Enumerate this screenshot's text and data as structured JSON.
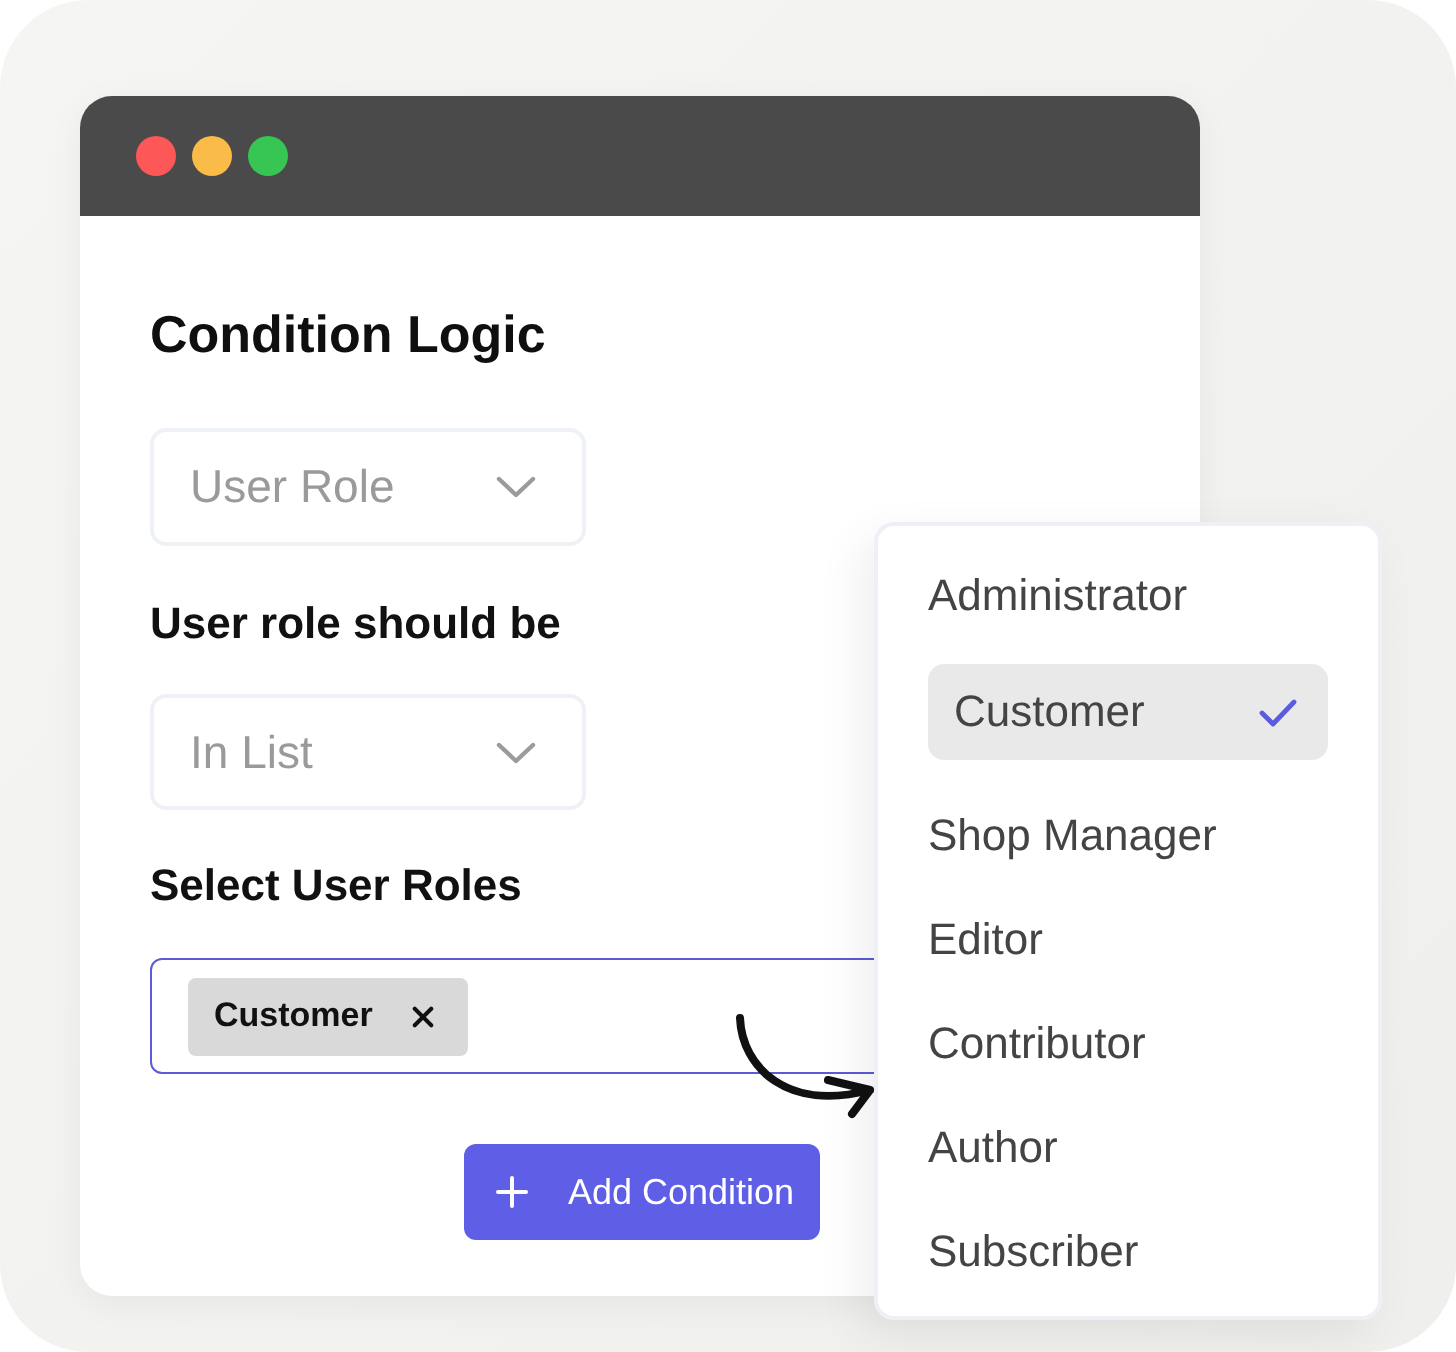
{
  "heading": "Condition Logic",
  "rule_select": {
    "value": "User Role"
  },
  "operator_label": "User role should be",
  "operator_select": {
    "value": "In List"
  },
  "roles_label": "Select User Roles",
  "roles_field": {
    "focused": true,
    "tags": [
      {
        "label": "Customer"
      }
    ]
  },
  "add_button": {
    "label": "Add Condition"
  },
  "roles_menu": {
    "items": [
      {
        "label": "Administrator",
        "selected": false
      },
      {
        "label": "Customer",
        "selected": true
      },
      {
        "label": "Shop Manager",
        "selected": false
      },
      {
        "label": "Editor",
        "selected": false
      },
      {
        "label": "Contributor",
        "selected": false
      },
      {
        "label": "Author",
        "selected": false
      },
      {
        "label": "Subscriber",
        "selected": false
      }
    ]
  }
}
